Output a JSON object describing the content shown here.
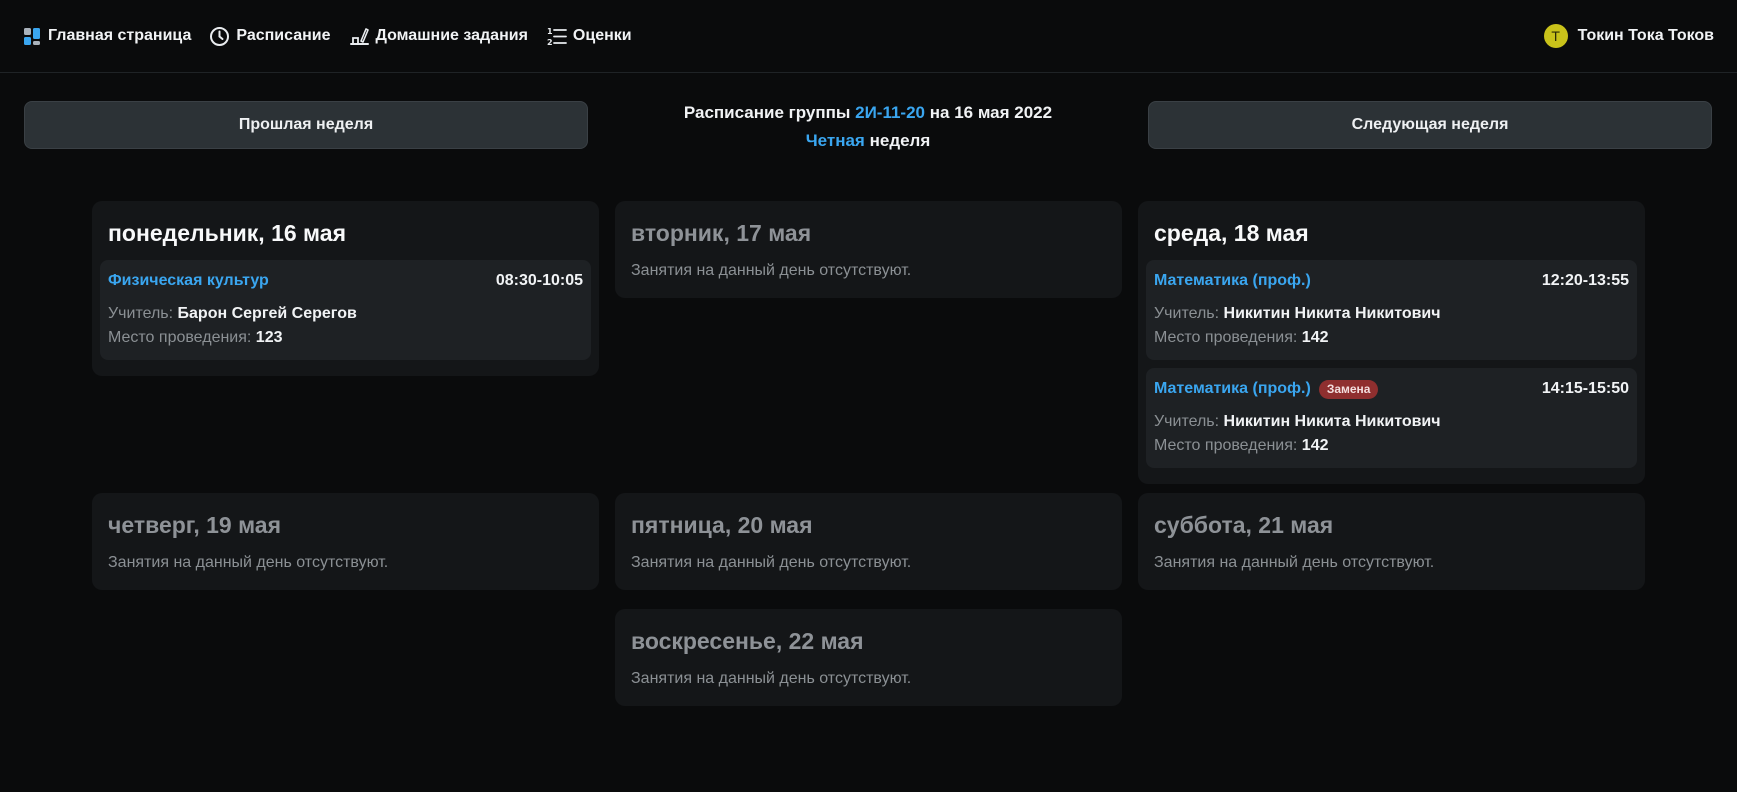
{
  "nav": {
    "items": [
      {
        "label": "Главная страница",
        "icon": "dashboard-icon"
      },
      {
        "label": "Расписание",
        "icon": "clock-icon"
      },
      {
        "label": "Домашние задания",
        "icon": "homework-icon"
      },
      {
        "label": "Оценки",
        "icon": "numbered-list-icon"
      }
    ],
    "user": {
      "initial": "T",
      "name": "Токин Тока Токов"
    }
  },
  "week": {
    "prev_label": "Прошлая неделя",
    "next_label": "Следующая неделя",
    "title_prefix": "Расписание группы",
    "group": "2И-11-20",
    "title_suffix": "на 16 мая 2022",
    "parity": "Четная",
    "parity_suffix": "неделя"
  },
  "empty_text": "Занятия на данный день отсутствуют.",
  "labels": {
    "teacher": "Учитель:",
    "place": "Место проведения:"
  },
  "days": [
    {
      "title": "понедельник, 16 мая",
      "lessons": [
        {
          "name": "Физическая культур",
          "time_start": "08:30",
          "time_end": "10:05",
          "teacher": "Барон Сергей Серегов",
          "place": "123"
        }
      ]
    },
    {
      "title": "вторник, 17 мая"
    },
    {
      "title": "среда, 18 мая",
      "lessons": [
        {
          "name": "Математика (проф.)",
          "time_start": "12:20",
          "time_end": "13:55",
          "teacher": "Никитин Никита Никитович",
          "place": "142"
        },
        {
          "name": "Математика (проф.)",
          "badge": "Замена",
          "time_start": "14:15",
          "time_end": "15:50",
          "teacher": "Никитин Никита Никитович",
          "place": "142"
        }
      ]
    },
    {
      "title": "четверг, 19 мая"
    },
    {
      "title": "пятница, 20 мая"
    },
    {
      "title": "суббота, 21 мая"
    },
    {
      "title": "воскресенье, 22 мая"
    }
  ],
  "colors": {
    "accent": "#3aa6f0",
    "badge": "#8f2f2f",
    "card": "#141618",
    "lesson": "#1e2124"
  }
}
